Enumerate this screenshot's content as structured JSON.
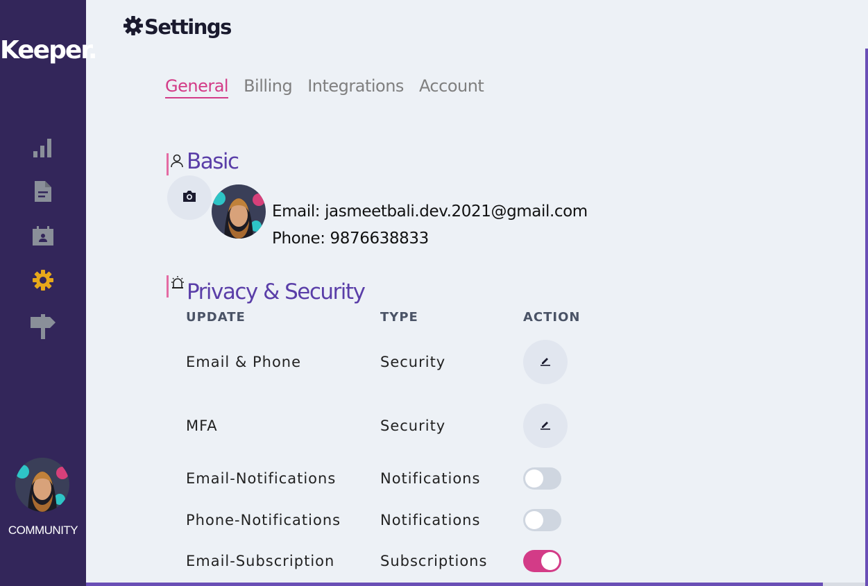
{
  "app": {
    "logo": "Keeper.",
    "community_label": "COMMUNITY"
  },
  "sidebar": {
    "icons": [
      {
        "name": "bar-chart-icon",
        "color": "#8a8f99"
      },
      {
        "name": "document-icon",
        "color": "#8a8f99"
      },
      {
        "name": "calendar-user-icon",
        "color": "#8a8f99"
      },
      {
        "name": "gear-icon",
        "color": "#e7a81a",
        "active": true
      },
      {
        "name": "signpost-icon",
        "color": "#8a8f99"
      }
    ]
  },
  "header": {
    "title": "Settings",
    "icon": "gear-icon"
  },
  "tabs": [
    {
      "label": "General",
      "active": true
    },
    {
      "label": "Billing"
    },
    {
      "label": "Integrations"
    },
    {
      "label": "Account"
    }
  ],
  "basic": {
    "title": "Basic",
    "icon": "user-icon",
    "email_line": "Email: jasmeetbali.dev.2021@gmail.com",
    "phone_line": "Phone: 9876638833"
  },
  "privacy": {
    "title": "Privacy & Security",
    "icon": "alarm-icon",
    "columns": [
      "UPDATE",
      "TYPE",
      "ACTION"
    ],
    "rows": [
      {
        "update": "Email & Phone",
        "type": "Security",
        "action": "edit"
      },
      {
        "update": "MFA",
        "type": "Security",
        "action": "edit"
      },
      {
        "update": "Email-Notifications",
        "type": "Notifications",
        "action": "toggle",
        "on": false
      },
      {
        "update": "Phone-Notifications",
        "type": "Notifications",
        "action": "toggle",
        "on": false
      },
      {
        "update": "Email-Subscription",
        "type": "Subscriptions",
        "action": "toggle",
        "on": true
      }
    ]
  },
  "colors": {
    "sidebar": "#33265a",
    "accent": "#d33b87",
    "heading": "#5a3ea8",
    "active_icon": "#e7a81a"
  }
}
